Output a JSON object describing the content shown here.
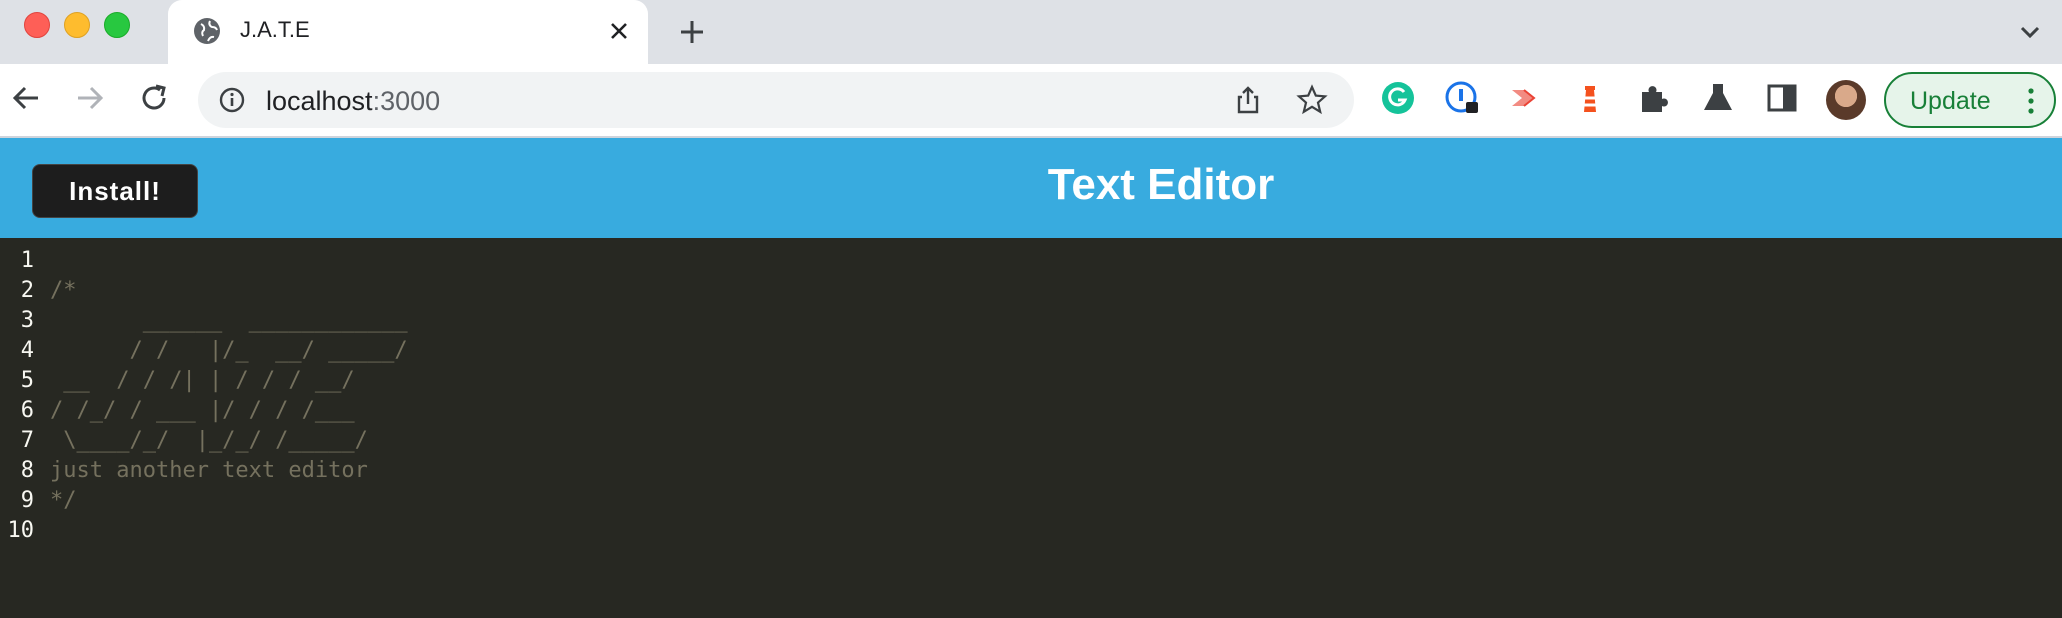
{
  "browser": {
    "tab_title": "J.A.T.E",
    "url_host": "localhost",
    "url_port": ":3000",
    "update_label": "Update"
  },
  "app": {
    "install_label": "Install!",
    "title": "Text Editor"
  },
  "editor": {
    "lines": [
      {
        "number": "1",
        "text": ""
      },
      {
        "number": "2",
        "text": "/*"
      },
      {
        "number": "3",
        "text": "       ______  ____________"
      },
      {
        "number": "4",
        "text": "      / /   |/_  __/ _____/"
      },
      {
        "number": "5",
        "text": " __  / / /| | / / / __/"
      },
      {
        "number": "6",
        "text": "/ /_/ / ___ |/ / / /___"
      },
      {
        "number": "7",
        "text": " \\____/_/  |_/_/ /_____/"
      },
      {
        "number": "8",
        "text": "just another text editor"
      },
      {
        "number": "9",
        "text": "*/"
      },
      {
        "number": "10",
        "text": ""
      }
    ]
  }
}
